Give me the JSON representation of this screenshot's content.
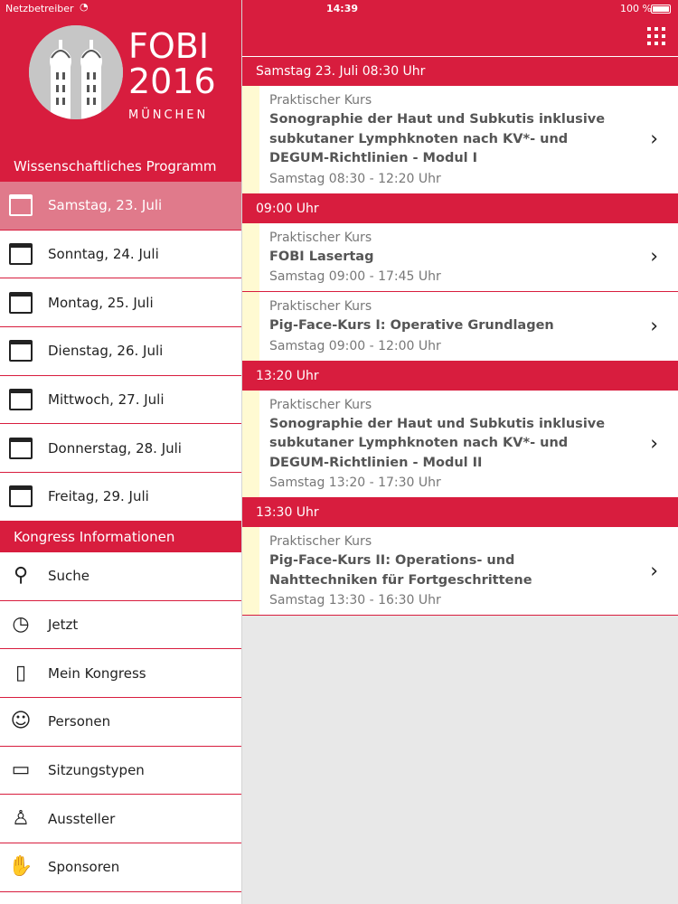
{
  "status": {
    "carrier": "Netzbetreiber",
    "time": "14:39",
    "battery": "100 %"
  },
  "logo": {
    "line1": "FOBI",
    "line2": "2016",
    "line3": "MÜNCHEN"
  },
  "sidebar": {
    "section1": "Wissenschaftliches Programm",
    "days": [
      {
        "label": "Samstag, 23. Juli",
        "active": true
      },
      {
        "label": "Sonntag, 24. Juli"
      },
      {
        "label": "Montag, 25. Juli"
      },
      {
        "label": "Dienstag, 26. Juli"
      },
      {
        "label": "Mittwoch, 27. Juli"
      },
      {
        "label": "Donnerstag, 28. Juli"
      },
      {
        "label": "Freitag, 29. Juli"
      }
    ],
    "section2": "Kongress Informationen",
    "info": [
      {
        "label": "Suche",
        "icon": "search-icon"
      },
      {
        "label": "Jetzt",
        "icon": "clock-icon"
      },
      {
        "label": "Mein Kongress",
        "icon": "bookmark-book-icon"
      },
      {
        "label": "Personen",
        "icon": "people-icon"
      },
      {
        "label": "Sitzungstypen",
        "icon": "stack-icon"
      },
      {
        "label": "Aussteller",
        "icon": "presenter-icon"
      },
      {
        "label": "Sponsoren",
        "icon": "handshake-icon"
      }
    ]
  },
  "main": {
    "groups": [
      {
        "header": "Samstag 23. Juli 08:30 Uhr",
        "sessions": [
          {
            "type": "Praktischer Kurs",
            "title": "Sonographie der Haut und Subkutis inklusive subkutaner Lymphknoten nach KV*- und DEGUM-Richtlinien - Modul I",
            "time": "Samstag 08:30 - 12:20 Uhr"
          }
        ]
      },
      {
        "header": "09:00 Uhr",
        "sessions": [
          {
            "type": "Praktischer Kurs",
            "title": "FOBI Lasertag",
            "time": "Samstag 09:00 - 17:45 Uhr"
          },
          {
            "type": "Praktischer Kurs",
            "title": "Pig-Face-Kurs I: Operative Grundlagen",
            "time": "Samstag 09:00 - 12:00 Uhr"
          }
        ]
      },
      {
        "header": "13:20 Uhr",
        "sessions": [
          {
            "type": "Praktischer Kurs",
            "title": "Sonographie der Haut und Subkutis inklusive subkutaner Lymphknoten nach KV*- und DEGUM-Richtlinien - Modul II",
            "time": "Samstag 13:20 - 17:30 Uhr"
          }
        ]
      },
      {
        "header": "13:30 Uhr",
        "sessions": [
          {
            "type": "Praktischer Kurs",
            "title": "Pig-Face-Kurs II: Operations- und Nahttechniken für Fortgeschrittene",
            "time": "Samstag 13:30 - 16:30 Uhr"
          }
        ]
      }
    ]
  },
  "colors": {
    "accent": "#d81d3e",
    "active": "#e07a8b",
    "stripe": "#fffad2"
  }
}
